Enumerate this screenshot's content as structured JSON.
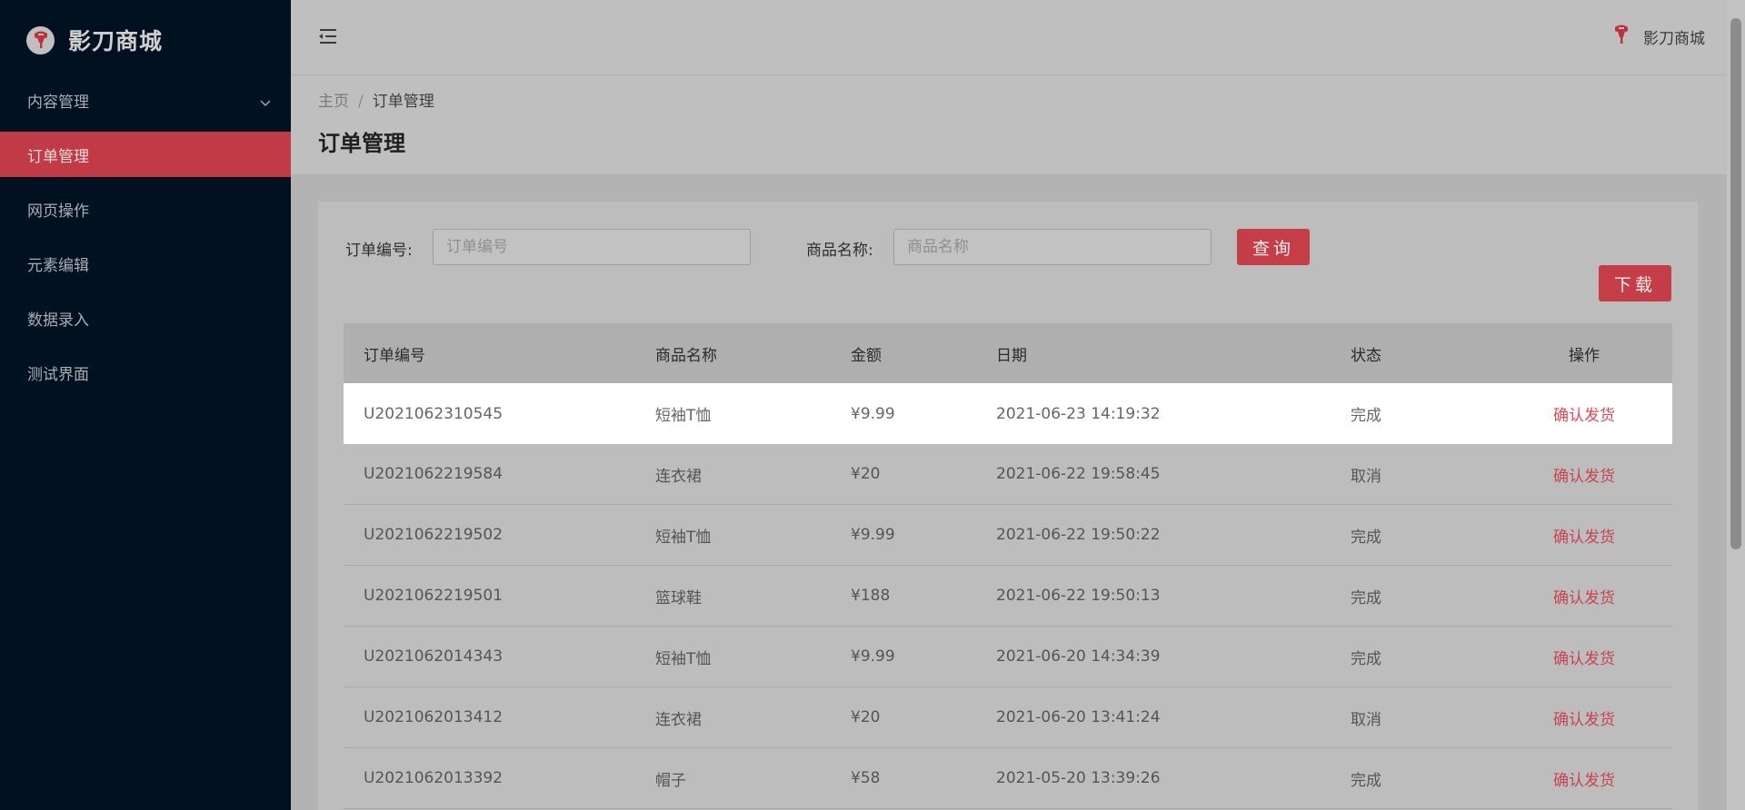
{
  "app": {
    "name": "影刀商城"
  },
  "sidebar": {
    "items": [
      {
        "label": "内容管理"
      },
      {
        "label": "订单管理"
      },
      {
        "label": "网页操作"
      },
      {
        "label": "元素编辑"
      },
      {
        "label": "数据录入"
      },
      {
        "label": "测试界面"
      }
    ]
  },
  "header": {
    "user_label": "影刀商城"
  },
  "breadcrumb": {
    "home": "主页",
    "separator": "/",
    "current": "订单管理"
  },
  "page": {
    "title": "订单管理"
  },
  "filters": {
    "order_no_label": "订单编号:",
    "order_no_placeholder": "订单编号",
    "product_label": "商品名称:",
    "product_placeholder": "商品名称",
    "query_button": "查询",
    "download_button": "下载"
  },
  "table": {
    "headers": [
      "订单编号",
      "商品名称",
      "金额",
      "日期",
      "状态",
      "操作"
    ],
    "rows": [
      [
        "U2021062310545",
        "短袖T恤",
        "¥9.99",
        "2021-06-23 14:19:32",
        "完成",
        "确认发货"
      ],
      [
        "U2021062219584",
        "连衣裙",
        "¥20",
        "2021-06-22 19:58:45",
        "取消",
        "确认发货"
      ],
      [
        "U2021062219502",
        "短袖T恤",
        "¥9.99",
        "2021-06-22 19:50:22",
        "完成",
        "确认发货"
      ],
      [
        "U2021062219501",
        "篮球鞋",
        "¥188",
        "2021-06-22 19:50:13",
        "完成",
        "确认发货"
      ],
      [
        "U2021062014343",
        "短袖T恤",
        "¥9.99",
        "2021-06-20 14:34:39",
        "完成",
        "确认发货"
      ],
      [
        "U2021062013412",
        "连衣裙",
        "¥20",
        "2021-06-20 13:41:24",
        "取消",
        "确认发货"
      ],
      [
        "U2021062013392",
        "帽子",
        "¥58",
        "2021-05-20 13:39:26",
        "完成",
        "确认发货"
      ]
    ]
  },
  "colors": {
    "accent": "#c53e47",
    "sidebar_bg": "#021120"
  }
}
